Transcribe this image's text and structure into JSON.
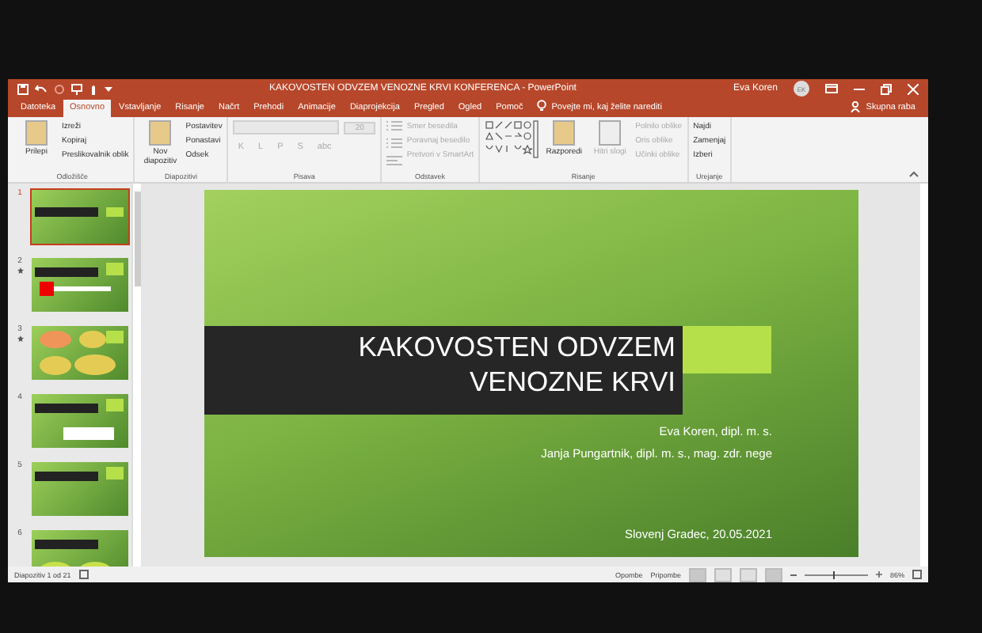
{
  "window": {
    "title": "KAKOVOSTEN ODVZEM VENOZNE KRVI KONFERENCA  -  PowerPoint",
    "user": "Eva Koren",
    "avatar": "EK"
  },
  "tabs": [
    {
      "label": "Datoteka",
      "selected": false
    },
    {
      "label": "Osnovno",
      "selected": true
    },
    {
      "label": "Vstavljanje",
      "selected": false
    },
    {
      "label": "Risanje",
      "selected": false
    },
    {
      "label": "Načrt",
      "selected": false
    },
    {
      "label": "Prehodi",
      "selected": false
    },
    {
      "label": "Animacije",
      "selected": false
    },
    {
      "label": "Diaprojekcija",
      "selected": false
    },
    {
      "label": "Pregled",
      "selected": false
    },
    {
      "label": "Ogled",
      "selected": false
    },
    {
      "label": "Pomoč",
      "selected": false
    }
  ],
  "tell_me": "Povejte mi, kaj želite narediti",
  "share": "Skupna raba",
  "ribbon": [
    {
      "label": "Odložišče",
      "large": [
        {
          "label": "Prilepi",
          "disabled": false
        }
      ],
      "small": [
        {
          "label": "Izreži",
          "disabled": false
        },
        {
          "label": "Kopiraj",
          "disabled": false
        },
        {
          "label": "Preslikovalnik oblik",
          "disabled": false
        }
      ]
    },
    {
      "label": "Diapozitivi",
      "large": [
        {
          "label": "Nov diapozitiv",
          "disabled": false
        }
      ],
      "small": [
        {
          "label": "Postavitev",
          "disabled": false
        },
        {
          "label": "Ponastavi",
          "disabled": false
        },
        {
          "label": "Odsek",
          "disabled": false
        }
      ]
    },
    {
      "label": "Pisava",
      "font_size": "20",
      "glyphs": [
        "K",
        "L",
        "P",
        "S",
        "abc"
      ]
    },
    {
      "label": "Odstavek",
      "small": [
        {
          "label": "Smer besedila",
          "disabled": true
        },
        {
          "label": "Poravnaj besedilo",
          "disabled": true
        },
        {
          "label": "Pretvori v SmartArt",
          "disabled": true
        }
      ]
    },
    {
      "label": "Risanje",
      "shapes": true,
      "large": [
        {
          "label": "Razporedi",
          "disabled": false
        },
        {
          "label": "Hitri slogi",
          "disabled": true
        }
      ],
      "small": [
        {
          "label": "Polnilo oblike",
          "disabled": true
        },
        {
          "label": "Oris oblike",
          "disabled": true
        },
        {
          "label": "Učinki oblike",
          "disabled": true
        }
      ]
    },
    {
      "label": "Urejanje",
      "small": [
        {
          "label": "Najdi",
          "disabled": false
        },
        {
          "label": "Zamenjaj",
          "disabled": false
        },
        {
          "label": "Izberi",
          "disabled": false
        }
      ]
    }
  ],
  "thumbnails": [
    {
      "number": "1",
      "selected": true,
      "animated": false,
      "kind": "title"
    },
    {
      "number": "2",
      "selected": false,
      "animated": true,
      "kind": "arrow"
    },
    {
      "number": "3",
      "selected": false,
      "animated": true,
      "kind": "ovals"
    },
    {
      "number": "4",
      "selected": false,
      "animated": false,
      "kind": "content"
    },
    {
      "number": "5",
      "selected": false,
      "animated": false,
      "kind": "text"
    },
    {
      "number": "6",
      "selected": false,
      "animated": false,
      "kind": "two-ovals"
    }
  ],
  "slide": {
    "title": "KAKOVOSTEN ODVZEM\nVENOZNE KRVI",
    "authors": [
      "Eva Koren, dipl. m. s.",
      "Janja Pungartnik, dipl. m. s., mag. zdr. nege"
    ],
    "place_date": "Slovenj Gradec, 20.05.2021"
  },
  "status_bar": {
    "slide_count": "Diapozitiv 1 od 21",
    "notes": "Opombe",
    "comments": "Pripombe",
    "zoom": "86%",
    "zoom_slider": {
      "level": 0.45
    }
  }
}
